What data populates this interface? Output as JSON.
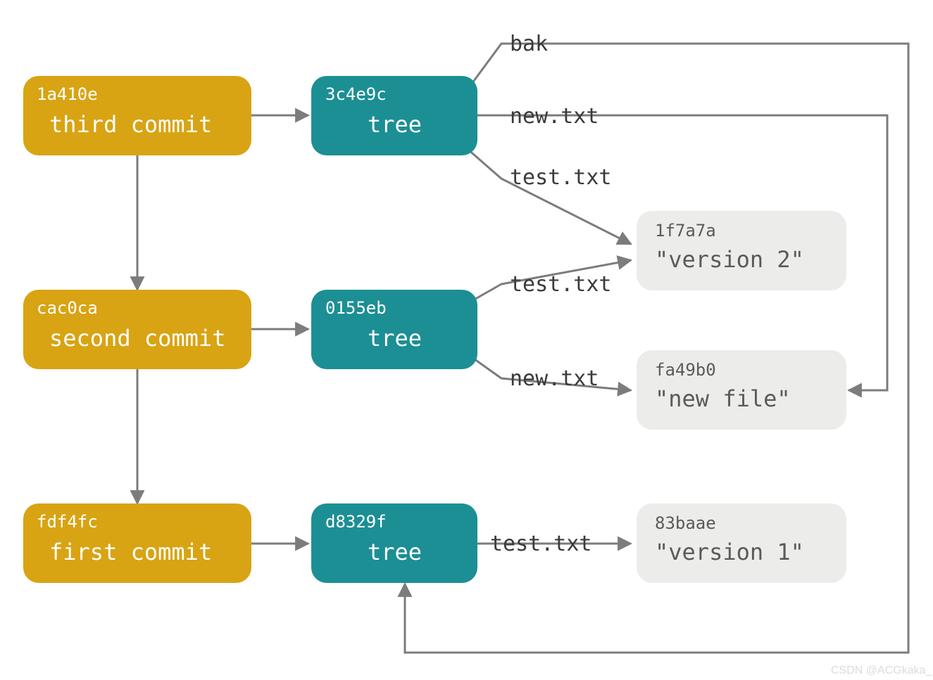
{
  "commits": {
    "c1": {
      "hash": "1a410e",
      "label": "third commit"
    },
    "c2": {
      "hash": "cac0ca",
      "label": "second commit"
    },
    "c3": {
      "hash": "fdf4fc",
      "label": "first commit"
    }
  },
  "trees": {
    "t1": {
      "hash": "3c4e9c",
      "label": "tree"
    },
    "t2": {
      "hash": "0155eb",
      "label": "tree"
    },
    "t3": {
      "hash": "d8329f",
      "label": "tree"
    }
  },
  "blobs": {
    "b1": {
      "hash": "1f7a7a",
      "label": "\"version 2\""
    },
    "b2": {
      "hash": "fa49b0",
      "label": "\"new file\""
    },
    "b3": {
      "hash": "83baae",
      "label": "\"version 1\""
    }
  },
  "edgeLabels": {
    "bak": "bak",
    "newtxt": "new.txt",
    "testtxt": "test.txt"
  },
  "watermark": "CSDN @ACGkaka_"
}
